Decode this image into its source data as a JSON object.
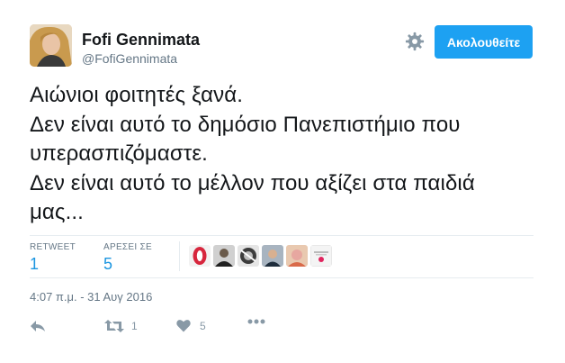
{
  "user": {
    "display_name": "Fofi Gennimata",
    "handle": "@FofiGennimata"
  },
  "header": {
    "follow_label": "Ακολουθείτε",
    "settings_icon": "gear-icon"
  },
  "tweet": {
    "lines": [
      "Αιώνιοι φοιτητές ξανά.",
      "Δεν είναι αυτό το δημόσιο Πανεπιστήμιο που",
      "υπερασπιζόμαστε.",
      "Δεν είναι αυτό το μέλλον που αξίζει στα παιδιά",
      "μας..."
    ]
  },
  "stats": {
    "retweets_label": "RETWEET",
    "retweets_value": "1",
    "likes_label": "ΑΡΕΣΕΙ ΣΕ",
    "likes_value": "5"
  },
  "timestamp": "4:07 π.μ. - 31 Αυγ 2016",
  "actions": {
    "reply_icon": "reply-icon",
    "retweet_icon": "retweet-icon",
    "retweet_count": "1",
    "like_icon": "heart-icon",
    "like_count": "5",
    "more_icon": "more-icon"
  },
  "colors": {
    "accent": "#1da1f2",
    "stat_value": "#1b95e0",
    "muted": "#657786",
    "icon": "#8899a6"
  }
}
